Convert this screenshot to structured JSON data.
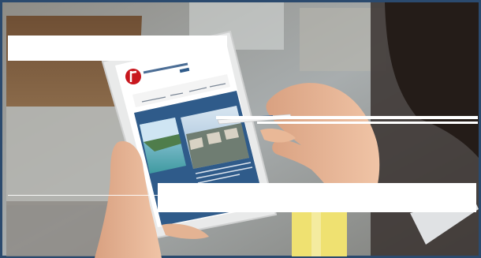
{
  "scene": {
    "subject": "hand-holding-tablet-with-stylus",
    "colors": {
      "frame": "#2b4a6e",
      "wood": "#7a5a3c",
      "background": "#9aa3a8",
      "skin": "#e2b291",
      "hair": "#2a211c",
      "tablet_body": "#f2f2f2",
      "site_blue": "#2f5b8a",
      "brand_red": "#c8171e",
      "stylus": "#f3f3f3",
      "cup": "#f0e46e"
    },
    "tablet_screen": {
      "logo_icon": "red-circle-logo-icon",
      "has_nav_bar": true,
      "thumbnail_count": 2
    },
    "overlays": {
      "white_bars": 5,
      "stylus_highlight": true
    }
  }
}
